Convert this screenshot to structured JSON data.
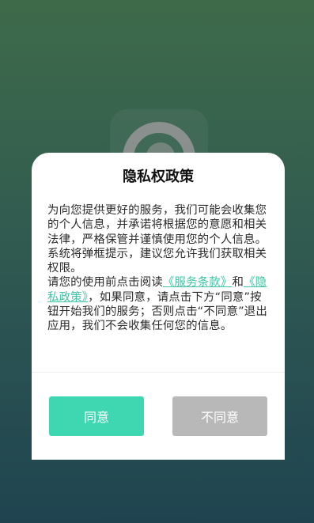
{
  "dialog": {
    "title": "隐私权政策",
    "paragraph1": "为向您提供更好的服务，我们可能会收集您的个人信息，并承诺将根据您的意愿和相关法律，严格保管并谨慎使用您的个人信息。系统将弹框提示，建议您允许我们获取相关权限。",
    "paragraph2_prefix": "请您的使用前点击阅读",
    "terms_link": "《服务条款》",
    "paragraph2_and": "和",
    "privacy_link": "《隐私政策》",
    "paragraph2_suffix": "，如果同意，请点击下方“同意”按钮开始我们的服务；否则点击“不同意”退出应用，我们不会收集任何您的信息。",
    "agree_label": "同意",
    "disagree_label": "不同意"
  },
  "colors": {
    "accent": "#3fd7b1",
    "link": "#3cc6a3",
    "disabled": "#b8b8b8"
  }
}
